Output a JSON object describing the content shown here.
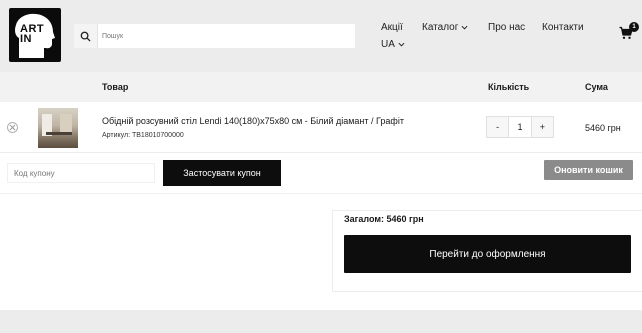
{
  "header": {
    "logo_text": "ART IN",
    "search": {
      "placeholder": "Пошук"
    },
    "nav": {
      "actions": "Акції",
      "catalog": "Каталог",
      "about": "Про нас",
      "contacts": "Контакти",
      "language": "UA"
    },
    "cart_count": "1"
  },
  "table": {
    "headers": {
      "product": "Товар",
      "quantity": "Кількість",
      "sum": "Сума"
    },
    "items": [
      {
        "name": "Обідній розсувний стіл Lendi 140(180)x75x80 см - Білий діамант / Графіт",
        "sku": "Артикул: TB18010700000",
        "quantity": "1",
        "price": "5460 грн",
        "minus": "-",
        "plus": "+"
      }
    ]
  },
  "coupon": {
    "placeholder": "Код купону",
    "apply_label": "Застосувати купон",
    "update_label": "Оновити кошик"
  },
  "totals": {
    "total_label": "Загалом: 5460 грн",
    "checkout_label": "Перейти до оформлення"
  },
  "colors": {
    "primary_dark": "#0d0d0d",
    "muted_button": "#8b8b8b",
    "header_bg": "#ececec"
  }
}
